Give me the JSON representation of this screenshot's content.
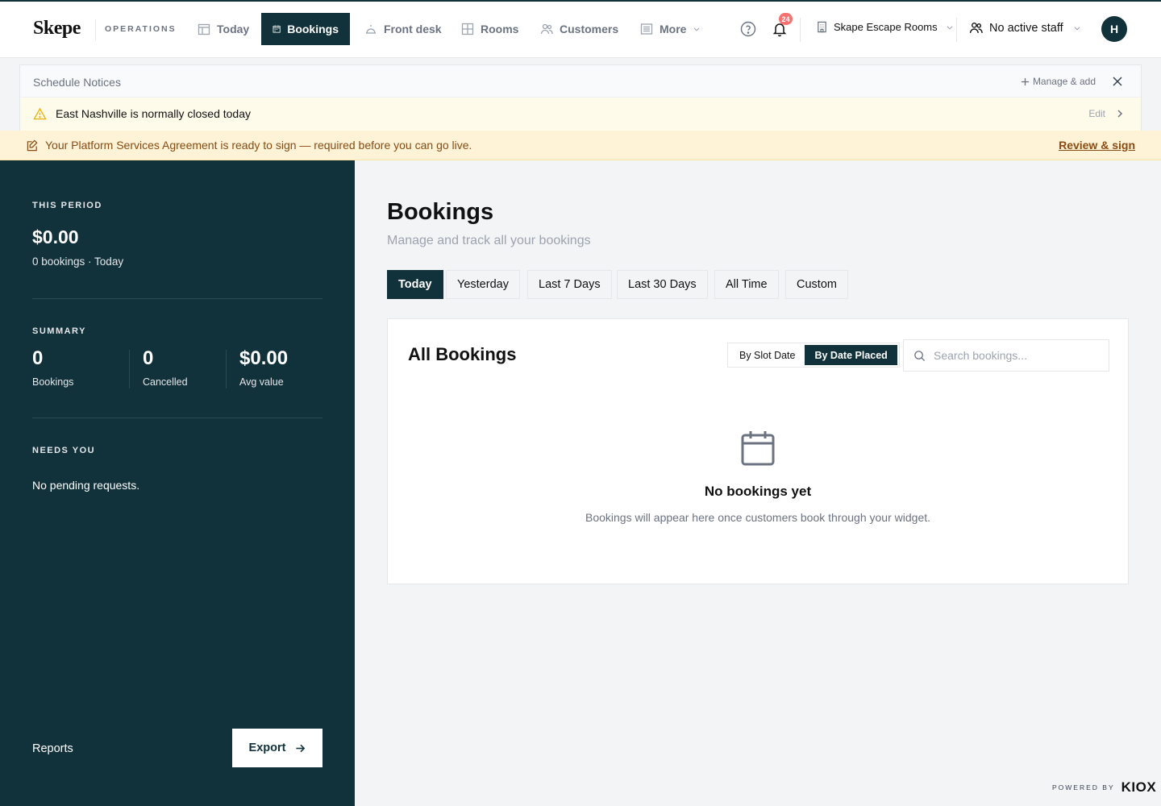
{
  "brand": {
    "logo": "Skepe",
    "section": "OPERATIONS"
  },
  "nav": [
    {
      "label": "Today"
    },
    {
      "label": "Bookings"
    },
    {
      "label": "Front desk"
    },
    {
      "label": "Rooms"
    },
    {
      "label": "Customers"
    },
    {
      "label": "More"
    }
  ],
  "header": {
    "notification_count": "24",
    "org_name": "Skape Escape Rooms",
    "staff_label": "No active staff",
    "avatar_initial": "H"
  },
  "notices": {
    "title": "Schedule Notices",
    "manage_label": "Manage & add",
    "items": [
      {
        "text": "East Nashville is normally closed today",
        "action": "Edit"
      }
    ]
  },
  "agreement": {
    "text": "Your Platform Services Agreement is ready to sign — required before you can go live.",
    "link": "Review & sign"
  },
  "sidebar": {
    "period_label": "THIS PERIOD",
    "period_amount": "$0.00",
    "period_sub": "0 bookings · Today",
    "summary_label": "SUMMARY",
    "stats": [
      {
        "value": "0",
        "label": "Bookings"
      },
      {
        "value": "0",
        "label": "Cancelled"
      },
      {
        "value": "$0.00",
        "label": "Avg value"
      }
    ],
    "needs_label": "NEEDS YOU",
    "needs_text": "No pending requests.",
    "reports_label": "Reports",
    "export_label": "Export"
  },
  "main": {
    "title": "Bookings",
    "subtitle": "Manage and track all your bookings",
    "ranges": [
      "Today",
      "Yesterday",
      "Last 7 Days",
      "Last 30 Days",
      "All Time",
      "Custom"
    ],
    "card_title": "All Bookings",
    "toggle": [
      "By Slot Date",
      "By Date Placed"
    ],
    "search_placeholder": "Search bookings...",
    "empty_title": "No bookings yet",
    "empty_sub": "Bookings will appear here once customers book through your widget."
  },
  "footer": {
    "powered_label": "POWERED BY",
    "powered_brand": "KIOX"
  },
  "colors": {
    "primary": "#12323b",
    "notice_bg": "#fffbeb",
    "agreement_bg": "#fef3d7",
    "badge": "#f87171"
  }
}
